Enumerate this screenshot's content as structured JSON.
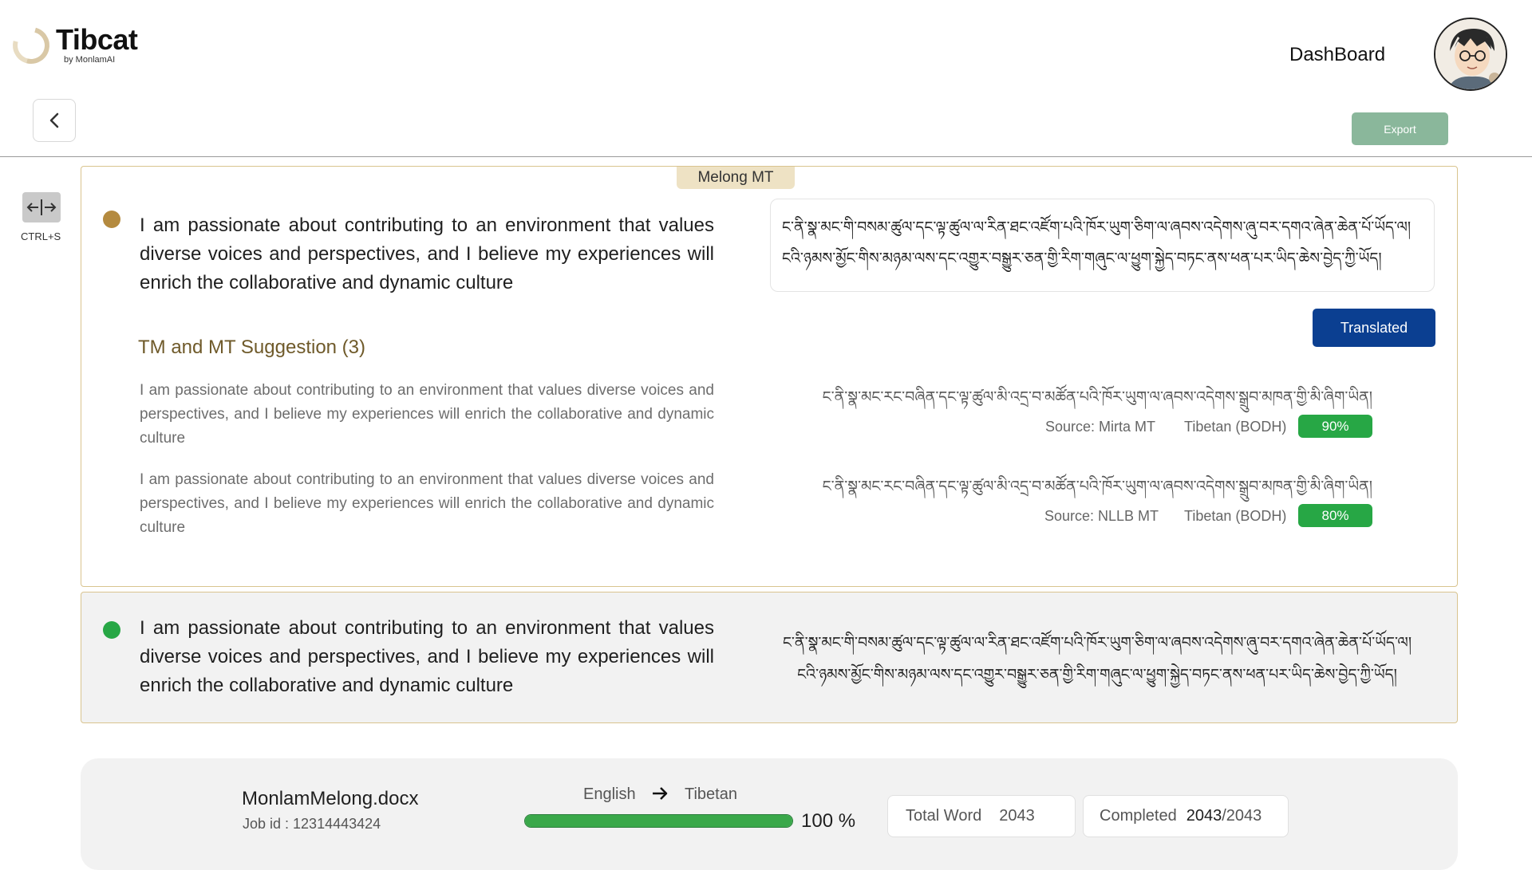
{
  "header": {
    "logo_title": "Tibcat",
    "logo_subtitle": "by MonlamAI",
    "dashboard_label": "DashBoard"
  },
  "toolbar": {
    "export_label": "Export",
    "shortcut_label": "CTRL+S"
  },
  "segments": [
    {
      "engine": "Melong MT",
      "source": "I am passionate about contributing to an environment that values diverse voices and perspectives, and I believe my experiences will enrich the collaborative and dynamic culture",
      "target": "ང་ནི་སྣ་མང་གི་བསམ་ཚུལ་དང་ལྟ་ཚུལ་ལ་རིན་ཐང་འཛོག་པའི་ཁོར་ཡུག་ཅིག་ལ་ཞབས་འདེགས་ཞུ་བར་དགའ་ཞེན་ཆེན་པོ་ཡོད་ལ། ངའི་ཉམས་མྱོང་གིས་མཉམ་ལས་དང་འགྱུར་བསྒྱུར་ཅན་གྱི་རིག་གཞུང་ལ་ཕྱུག་སྐྱེད་བཏང་ནས་ཕན་པར་ཡིད་ཆེས་བྱེད་ཀྱི་ཡོད།",
      "status_label": "Translated",
      "suggestions_title": "TM and  MT Suggestion (3)",
      "suggestions": [
        {
          "source": "I am passionate about contributing to an environment that values diverse voices and perspectives, and I believe my experiences will enrich the collaborative and dynamic culture",
          "target": "ང་ནི་སྣ་མང་རང་བཞིན་དང་ལྟ་ཚུལ་མི་འདྲ་བ་མཚོན་པའི་ཁོར་ཡུག་ལ་ཞབས་འདེགས་སྒྲུབ་མཁན་གྱི་མི་ཞིག་ཡིན།",
          "source_label": "Source: Mirta MT",
          "language_label": "Tibetan (BODH)",
          "score": "90%"
        },
        {
          "source": "I am passionate about contributing to an environment that values diverse voices and perspectives, and I believe my experiences will enrich the collaborative and dynamic culture",
          "target": "ང་ནི་སྣ་མང་རང་བཞིན་དང་ལྟ་ཚུལ་མི་འདྲ་བ་མཚོན་པའི་ཁོར་ཡུག་ལ་ཞབས་འདེགས་སྒྲུབ་མཁན་གྱི་མི་ཞིག་ཡིན།",
          "source_label": "Source: NLLB MT",
          "language_label": "Tibetan (BODH)",
          "score": "80%"
        }
      ]
    },
    {
      "source": "I am passionate about contributing to an environment that values diverse voices and perspectives, and I believe my experiences will enrich the collaborative and dynamic culture",
      "target": "ང་ནི་སྣ་མང་གི་བསམ་ཚུལ་དང་ལྟ་ཚུལ་ལ་རིན་ཐང་འཛོག་པའི་ཁོར་ཡུག་ཅིག་ལ་ཞབས་འདེགས་ཞུ་བར་དགའ་ཞེན་ཆེན་པོ་ཡོད་ལ། ངའི་ཉམས་མྱོང་གིས་མཉམ་ལས་དང་འགྱུར་བསྒྱུར་ཅན་གྱི་རིག་གཞུང་ལ་ཕྱུག་སྐྱེད་བཏང་ནས་ཕན་པར་ཡིད་ཆེས་བྱེད་ཀྱི་ཡོད།"
    }
  ],
  "footer": {
    "filename": "MonlamMelong.docx",
    "job_id": "Job id : 12314443424",
    "source_language": "English",
    "target_language": "Tibetan",
    "progress_fraction": 1.0,
    "progress_label": "100 %",
    "total_word_label": "Total Word",
    "total_word_value": "2043",
    "completed_label": "Completed",
    "completed_done": "2043",
    "completed_total": "/2043"
  },
  "colors": {
    "accent_gold": "#b48a3f",
    "translated_blue": "#0b3f91",
    "score_green": "#27a745",
    "export_green": "#8ab79b"
  }
}
